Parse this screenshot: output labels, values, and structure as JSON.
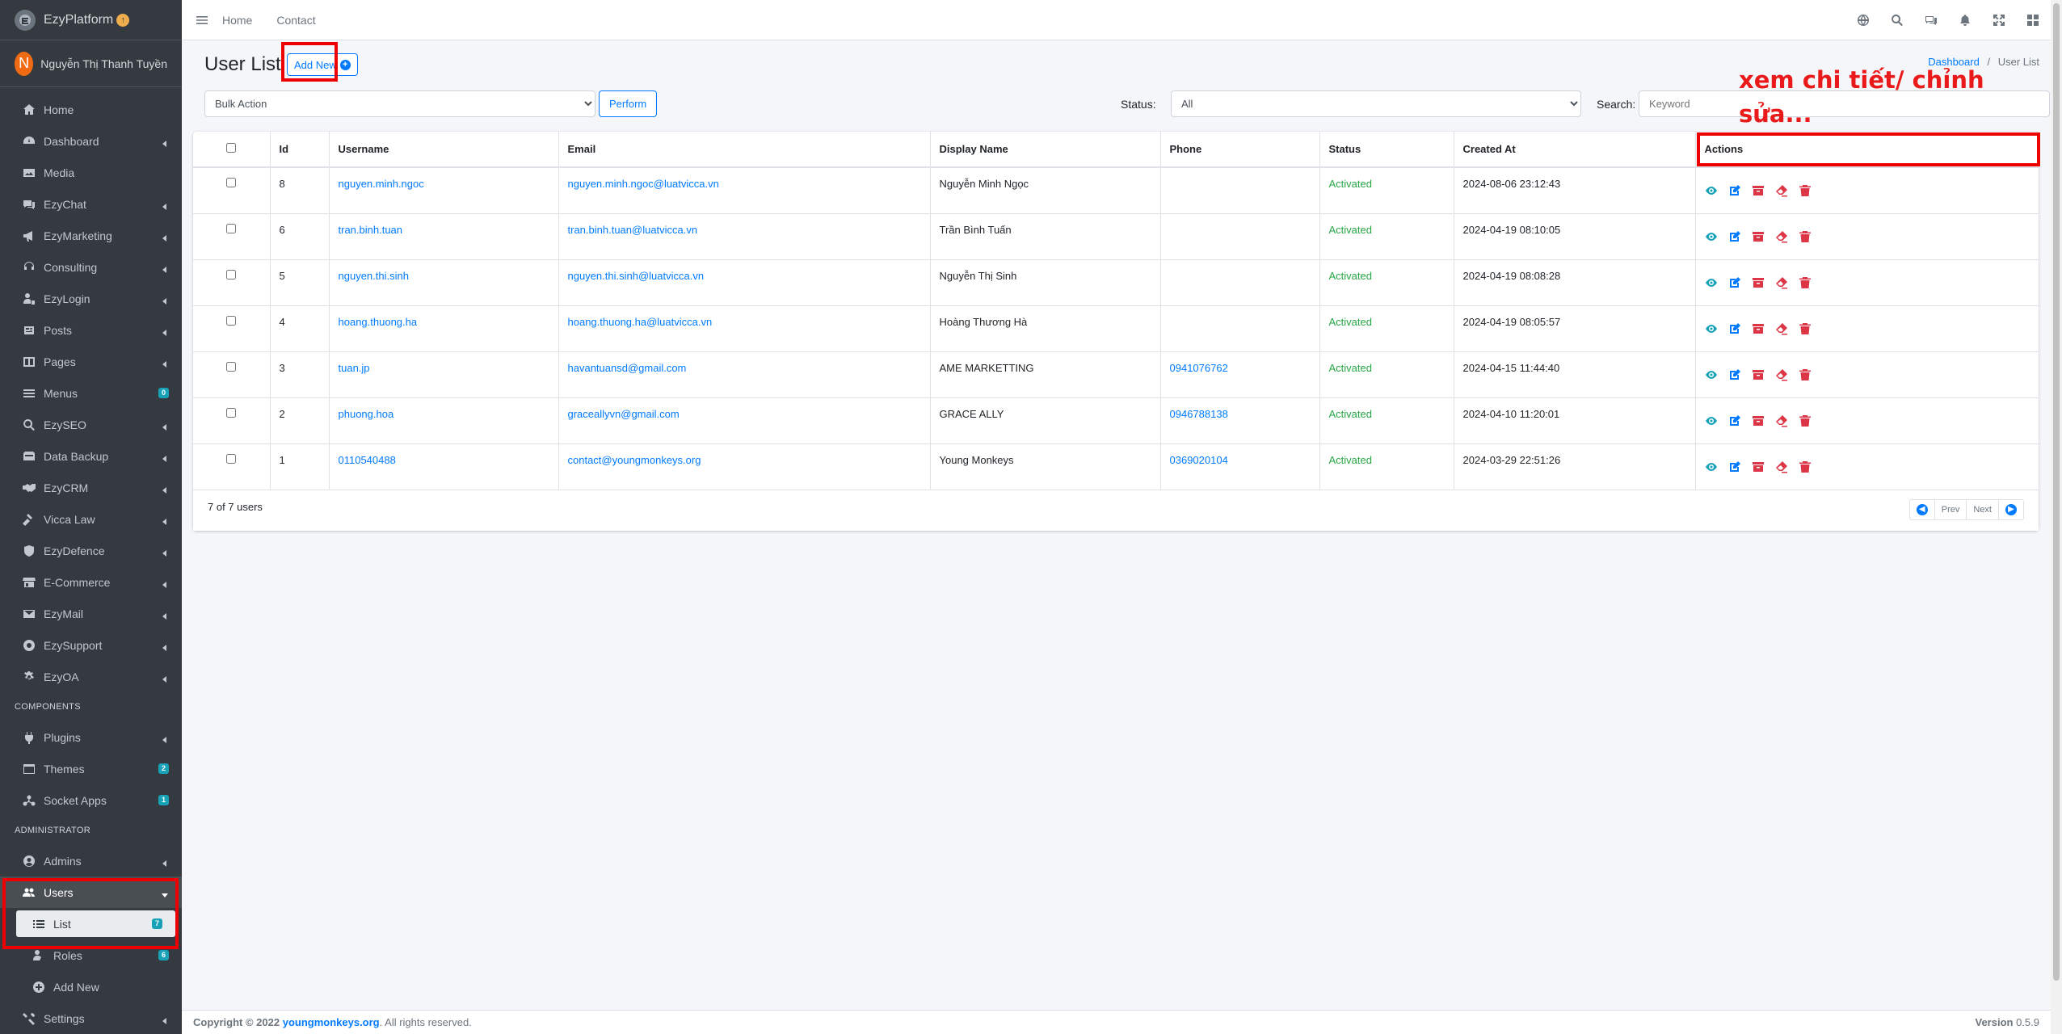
{
  "brand": {
    "name": "EzyPlatform"
  },
  "user": {
    "initial": "N",
    "name": "Nguyễn Thị Thanh Tuyền"
  },
  "sidebar": {
    "items": [
      {
        "label": "Home"
      },
      {
        "label": "Dashboard"
      },
      {
        "label": "Media"
      },
      {
        "label": "EzyChat"
      },
      {
        "label": "EzyMarketing"
      },
      {
        "label": "Consulting"
      },
      {
        "label": "EzyLogin"
      },
      {
        "label": "Posts"
      },
      {
        "label": "Pages"
      },
      {
        "label": "Menus",
        "badge": "0"
      },
      {
        "label": "EzySEO"
      },
      {
        "label": "Data Backup"
      },
      {
        "label": "EzyCRM"
      },
      {
        "label": "Vicca Law"
      },
      {
        "label": "EzyDefence"
      },
      {
        "label": "E-Commerce"
      },
      {
        "label": "EzyMail"
      },
      {
        "label": "EzySupport"
      },
      {
        "label": "EzyOA"
      }
    ],
    "components_header": "COMPONENTS",
    "components": [
      {
        "label": "Plugins"
      },
      {
        "label": "Themes",
        "badge": "2"
      },
      {
        "label": "Socket Apps",
        "badge": "1"
      }
    ],
    "admin_header": "ADMINISTRATOR",
    "admin": [
      {
        "label": "Admins"
      },
      {
        "label": "Users"
      },
      {
        "label": "List",
        "badge": "7"
      },
      {
        "label": "Roles",
        "badge": "6"
      },
      {
        "label": "Add New"
      },
      {
        "label": "Settings"
      }
    ]
  },
  "topbar": {
    "home": "Home",
    "contact": "Contact"
  },
  "page": {
    "title": "User List",
    "add_new": "Add New",
    "breadcrumb_root": "Dashboard",
    "breadcrumb_sep": "/",
    "breadcrumb_current": "User List",
    "annotation_line1": "xem chi tiết/ chỉnh",
    "annotation_line2": "sửa..."
  },
  "filters": {
    "bulk_action": "Bulk Action",
    "perform": "Perform",
    "status_label": "Status:",
    "status_value": "All",
    "search_label": "Search:",
    "search_placeholder": "Keyword"
  },
  "table": {
    "headers": {
      "id": "Id",
      "username": "Username",
      "email": "Email",
      "display_name": "Display Name",
      "phone": "Phone",
      "status": "Status",
      "created_at": "Created At",
      "actions": "Actions"
    },
    "rows": [
      {
        "id": "8",
        "username": "nguyen.minh.ngoc",
        "email": "nguyen.minh.ngoc@luatvicca.vn",
        "display_name": "Nguyễn Minh Ngọc",
        "phone": "",
        "status": "Activated",
        "created_at": "2024-08-06 23:12:43"
      },
      {
        "id": "6",
        "username": "tran.binh.tuan",
        "email": "tran.binh.tuan@luatvicca.vn",
        "display_name": "Trần Bình Tuấn",
        "phone": "",
        "status": "Activated",
        "created_at": "2024-04-19 08:10:05"
      },
      {
        "id": "5",
        "username": "nguyen.thi.sinh",
        "email": "nguyen.thi.sinh@luatvicca.vn",
        "display_name": "Nguyễn Thị Sinh",
        "phone": "",
        "status": "Activated",
        "created_at": "2024-04-19 08:08:28"
      },
      {
        "id": "4",
        "username": "hoang.thuong.ha",
        "email": "hoang.thuong.ha@luatvicca.vn",
        "display_name": "Hoàng Thương Hà",
        "phone": "",
        "status": "Activated",
        "created_at": "2024-04-19 08:05:57"
      },
      {
        "id": "3",
        "username": "tuan.jp",
        "email": "havantuansd@gmail.com",
        "display_name": "AME MARKETTING",
        "phone": "0941076762",
        "status": "Activated",
        "created_at": "2024-04-15 11:44:40"
      },
      {
        "id": "2",
        "username": "phuong.hoa",
        "email": "graceallyvn@gmail.com",
        "display_name": "GRACE ALLY",
        "phone": "0946788138",
        "status": "Activated",
        "created_at": "2024-04-10 11:20:01"
      },
      {
        "id": "1",
        "username": "0110540488",
        "email": "contact@youngmonkeys.org",
        "display_name": "Young Monkeys",
        "phone": "0369020104",
        "status": "Activated",
        "created_at": "2024-03-29 22:51:26"
      }
    ],
    "count_text": "7 of 7 users",
    "prev": "Prev",
    "next": "Next"
  },
  "footer": {
    "copyright": "Copyright © 2022 ",
    "link": "youngmonkeys.org",
    "rights": ". All rights reserved.",
    "version_label": "Version",
    "version": "0.5.9"
  },
  "colors": {
    "sidebar": "#343a40",
    "primary": "#007bff",
    "success": "#28a745",
    "danger": "#dc3545",
    "info": "#17a2b8",
    "annotation": "#ea1a1a"
  }
}
